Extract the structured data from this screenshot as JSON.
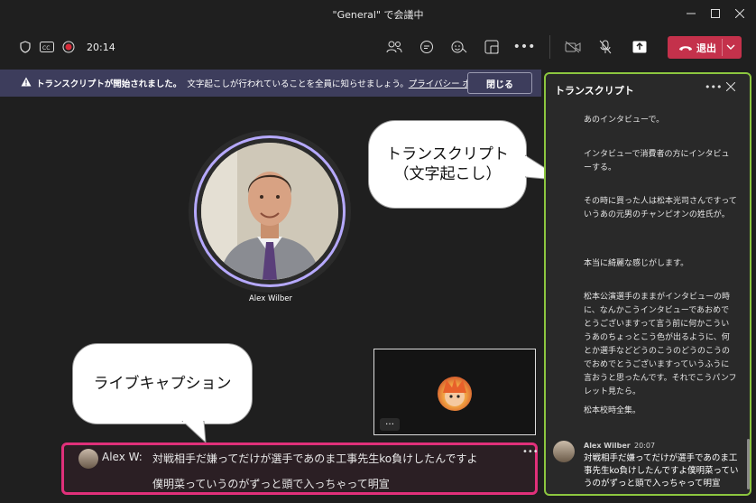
{
  "window": {
    "title": "\"General\" で会議中"
  },
  "toolbar": {
    "time": "20:14",
    "leave_label": "退出"
  },
  "banner": {
    "bold_text": "トランスクリプトが開始されました。",
    "message": "文字起こしが行われていることを全員に知らせましょう。",
    "link": "プライバシー ポリシー",
    "close_label": "閉じる"
  },
  "participant": {
    "name": "Alex Wilber"
  },
  "callouts": {
    "transcript": "トランスクリプト\n（文字起こし）",
    "live_caption": "ライブキャプション"
  },
  "caption": {
    "speaker": "Alex W:",
    "line1": "対戦相手だ嫌ってだけが選手であのま工事先生ko負けしたんですよ",
    "line2": "僕明菜っていうのがずっと頭で入っちゃって明宣"
  },
  "transcript_panel": {
    "title": "トランスクリプト",
    "entries": [
      "あのインタビューで。",
      "インタビューで消費者の方にインタビューする。",
      "その時に買った人は松本光司さんですっていうあの元男のチャンピオンの姓氏が。",
      "本当に綺麗な感じがします。",
      "松本公演選手のままがインタビューの時に、なんかこうインタビューであおめでとうございますって言う前に何かこういうあのちょっとこう色が出るように、何とか選手などどうのこうのどうのこうのでおめでとうございますっていうふうに言おうと思ったんです。それでこうパンフレット見たら。",
      "松本校時全集。"
    ],
    "last_entry": {
      "speaker": "Alex Wilber",
      "time": "20:07",
      "text": "対戦相手だ嫌ってだけが選手であのま工事先生ko負けしたんですよ僕明菜っていうのがずっと頭で入っちゃって明宣"
    }
  },
  "colors": {
    "leave_button": "#c4314b",
    "banner": "#3d3d5c",
    "panel_border": "#8cc63f",
    "caption_border": "#e0307a",
    "avatar_ring": "#b6a9ff"
  }
}
